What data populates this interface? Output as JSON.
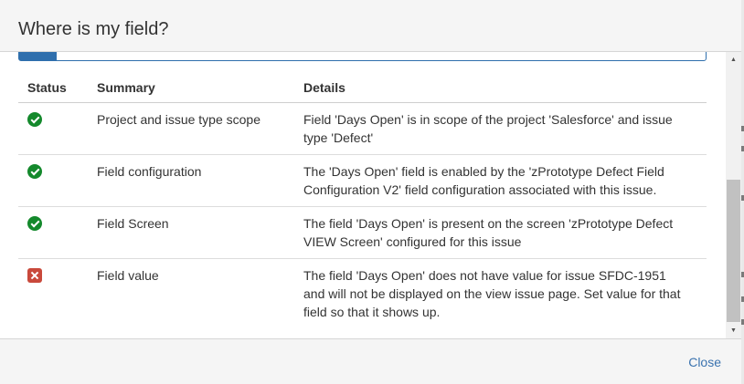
{
  "dialog": {
    "title": "Where is my field?"
  },
  "progress": {
    "fraction": 0.055,
    "color": "#2f6fad"
  },
  "table": {
    "headers": {
      "status": "Status",
      "summary": "Summary",
      "details": "Details"
    },
    "rows": [
      {
        "status": "ok",
        "status_icon": "check-circle-icon",
        "summary": "Project and issue type scope",
        "details": "Field 'Days Open' is in scope of the project 'Salesforce' and issue type 'Defect'"
      },
      {
        "status": "ok",
        "status_icon": "check-circle-icon",
        "summary": "Field configuration",
        "details": "The 'Days Open' field is enabled by the 'zPrototype Defect Field Configuration V2' field configuration associated with this issue."
      },
      {
        "status": "ok",
        "status_icon": "check-circle-icon",
        "summary": "Field Screen",
        "details": "The field 'Days Open' is present on the screen 'zPrototype Defect VIEW Screen' configured for this issue"
      },
      {
        "status": "error",
        "status_icon": "error-x-icon",
        "summary": "Field value",
        "details": "The field 'Days Open' does not have value for issue SFDC-1951 and will not be displayed on the view issue page. Set value for that field so that it shows up."
      }
    ]
  },
  "footer": {
    "close_label": "Close"
  },
  "colors": {
    "ok": "#14892c",
    "error": "#c9493b",
    "link": "#3b73af"
  }
}
